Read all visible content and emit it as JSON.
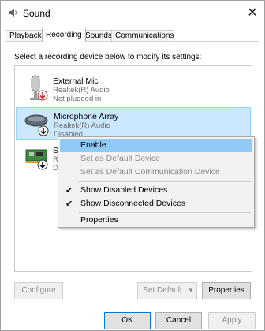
{
  "window": {
    "title": "Sound",
    "close_glyph": "✕"
  },
  "tabs": [
    "Playback",
    "Recording",
    "Sounds",
    "Communications"
  ],
  "active_tab": "Recording",
  "instruction": "Select a recording device below to modify its settings:",
  "devices": [
    {
      "name": "External Mic",
      "driver": "Realtek(R) Audio",
      "status": "Not plugged in",
      "icon": "microphone-icon",
      "badge": "red-down-arrow"
    },
    {
      "name": "Microphone Array",
      "driver": "Realtek(R) Audio",
      "status": "Disabled",
      "icon": "microphone-array-icon",
      "badge": "black-down-arrow"
    },
    {
      "name": "Ste",
      "driver": "Rea",
      "status": "Dis",
      "icon": "sound-card-icon",
      "badge": "black-down-arrow"
    }
  ],
  "context_menu": {
    "items": [
      {
        "label": "Enable",
        "state": "highlighted",
        "checked": false
      },
      {
        "label": "Set as Default Device",
        "state": "disabled",
        "checked": false
      },
      {
        "label": "Set as Default Communication Device",
        "state": "disabled",
        "checked": false
      },
      {
        "label": "Show Disabled Devices",
        "state": "normal",
        "checked": true
      },
      {
        "label": "Show Disconnected Devices",
        "state": "normal",
        "checked": true
      },
      {
        "label": "Properties",
        "state": "normal",
        "checked": false
      }
    ]
  },
  "buttons": {
    "configure": "Configure",
    "set_default": "Set Default",
    "properties": "Properties",
    "ok": "OK",
    "cancel": "Cancel",
    "apply": "Apply"
  },
  "colors": {
    "selection": "#cce8ff",
    "menu_highlight": "#91c9f7",
    "accent": "#0078d7",
    "disabled_text": "#8c8c8c"
  }
}
